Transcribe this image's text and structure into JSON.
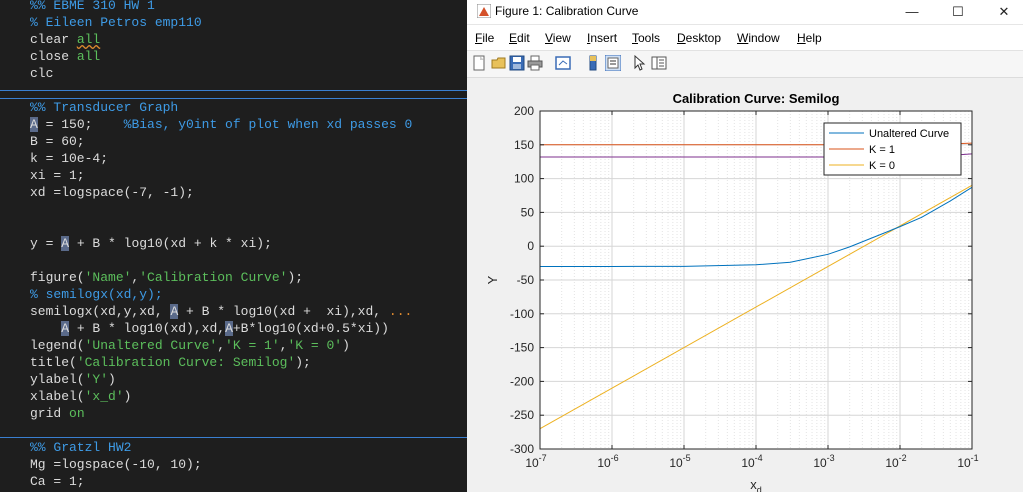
{
  "editor": {
    "lines": [
      {
        "id": "l0",
        "segs": [
          [
            "sec",
            "%% EBME 310 HW 1"
          ]
        ]
      },
      {
        "id": "l1",
        "segs": [
          [
            "cmt",
            "% Eileen Petros emp110"
          ]
        ]
      },
      {
        "id": "l2",
        "segs": [
          [
            "plain",
            "clear "
          ],
          [
            "kwsq",
            "all"
          ]
        ]
      },
      {
        "id": "l3",
        "segs": [
          [
            "plain",
            "close "
          ],
          [
            "kw",
            "all"
          ]
        ]
      },
      {
        "id": "l4",
        "segs": [
          [
            "plain",
            "clc"
          ]
        ]
      },
      {
        "id": "l5",
        "segs": [
          [
            "sec",
            "%% Transducer Graph"
          ]
        ]
      },
      {
        "id": "l6",
        "segs": [
          [
            "hl",
            "A"
          ],
          [
            "plain",
            " = 150;    "
          ],
          [
            "cmt",
            "%Bias, y0int of plot when xd passes 0"
          ]
        ]
      },
      {
        "id": "l7",
        "segs": [
          [
            "plain",
            "B = 60;"
          ]
        ]
      },
      {
        "id": "l8",
        "segs": [
          [
            "plain",
            "k = 10e-4;"
          ]
        ]
      },
      {
        "id": "l9",
        "segs": [
          [
            "plain",
            "xi = 1;"
          ]
        ]
      },
      {
        "id": "l10",
        "segs": [
          [
            "plain",
            "xd =logspace(-7, -1);"
          ]
        ]
      },
      {
        "id": "l11",
        "segs": [
          [
            "plain",
            "y = "
          ],
          [
            "hl",
            "A"
          ],
          [
            "plain",
            " + B * log10(xd + k * xi);"
          ]
        ]
      },
      {
        "id": "l12",
        "segs": [
          [
            "plain",
            "figure("
          ],
          [
            "str",
            "'Name'"
          ],
          [
            "plain",
            ","
          ],
          [
            "str",
            "'Calibration Curve'"
          ],
          [
            "plain",
            ");"
          ]
        ]
      },
      {
        "id": "l13",
        "segs": [
          [
            "cmt",
            "% semilogx(xd,y);"
          ]
        ]
      },
      {
        "id": "l14",
        "segs": [
          [
            "plain",
            "semilogx(xd,y,xd, "
          ],
          [
            "hl",
            "A"
          ],
          [
            "plain",
            " + B * log10(xd +  xi),xd, "
          ],
          [
            "cont",
            "..."
          ]
        ]
      },
      {
        "id": "l15",
        "segs": [
          [
            "plain",
            "    "
          ],
          [
            "hl",
            "A"
          ],
          [
            "plain",
            " + B * log10(xd),xd,"
          ],
          [
            "hl",
            "A"
          ],
          [
            "plain",
            "+B*log10(xd+0.5*xi))"
          ]
        ]
      },
      {
        "id": "l16",
        "segs": [
          [
            "plain",
            "legend("
          ],
          [
            "str",
            "'Unaltered Curve'"
          ],
          [
            "plain",
            ","
          ],
          [
            "str",
            "'K = 1'"
          ],
          [
            "plain",
            ","
          ],
          [
            "str",
            "'K = 0'"
          ],
          [
            "plain",
            ")"
          ]
        ]
      },
      {
        "id": "l17",
        "segs": [
          [
            "plain",
            "title("
          ],
          [
            "str",
            "'Calibration Curve: Semilog'"
          ],
          [
            "plain",
            ");"
          ]
        ]
      },
      {
        "id": "l18",
        "segs": [
          [
            "plain",
            "ylabel("
          ],
          [
            "str",
            "'Y'"
          ],
          [
            "plain",
            ")"
          ]
        ]
      },
      {
        "id": "l19",
        "segs": [
          [
            "plain",
            "xlabel("
          ],
          [
            "str",
            "'x_d'"
          ],
          [
            "plain",
            ")"
          ]
        ]
      },
      {
        "id": "l20",
        "segs": [
          [
            "plain",
            "grid "
          ],
          [
            "kw",
            "on"
          ]
        ]
      },
      {
        "id": "l21",
        "segs": [
          [
            "sec",
            "%% Gratzl HW2"
          ]
        ]
      },
      {
        "id": "l22",
        "segs": [
          [
            "plain",
            "Mg =logspace(-10, 10);"
          ]
        ]
      },
      {
        "id": "l23",
        "segs": [
          [
            "plain",
            "Ca = 1;"
          ]
        ]
      }
    ]
  },
  "window": {
    "title": "Figure 1: Calibration Curve",
    "controls": {
      "minimize": "—",
      "maximize": "☐",
      "close": "✕"
    }
  },
  "menu": {
    "items": [
      {
        "key": "F",
        "rest": "ile"
      },
      {
        "key": "E",
        "rest": "dit"
      },
      {
        "key": "V",
        "rest": "iew"
      },
      {
        "key": "I",
        "rest": "nsert"
      },
      {
        "key": "T",
        "rest": "ools"
      },
      {
        "key": "D",
        "rest": "esktop"
      },
      {
        "key": "W",
        "rest": "indow"
      },
      {
        "key": "H",
        "rest": "elp"
      }
    ]
  },
  "toolbar": {
    "icons": [
      "new-figure-icon",
      "open-file-icon",
      "save-icon",
      "print-icon",
      "link-plot-icon",
      "colorbar-icon",
      "legend-icon",
      "edit-plot-arrow-icon",
      "property-inspector-icon"
    ]
  },
  "colors": {
    "unaltered": "#0072BD",
    "k1": "#D95319",
    "k0": "#EDB120",
    "fourth": "#7E2F8E"
  },
  "chart_data": {
    "type": "line",
    "title": "Calibration Curve: Semilog",
    "xlabel": "x_d",
    "ylabel": "Y",
    "xscale": "log",
    "xlim": [
      1e-07,
      0.1
    ],
    "ylim": [
      -300,
      200
    ],
    "xticks": [
      "10^-7",
      "10^-6",
      "10^-5",
      "10^-4",
      "10^-3",
      "10^-2",
      "10^-1"
    ],
    "yticks": [
      "200",
      "150",
      "100",
      "50",
      "0",
      "-50",
      "-100",
      "-150",
      "-200",
      "-250",
      "-300"
    ],
    "grid": true,
    "legend_position": "top-right",
    "series": [
      {
        "name": "Unaltered Curve",
        "color": "#0072BD",
        "x": [
          1e-07,
          1e-06,
          1e-05,
          0.0001,
          0.0003,
          0.001,
          0.002,
          0.005,
          0.01,
          0.02,
          0.05,
          0.1
        ],
        "values": [
          -30.0,
          -30.0,
          -29.8,
          -27.5,
          -23.8,
          -12.0,
          -1.0,
          16.0,
          29.0,
          42.7,
          66.9,
          87.2
        ]
      },
      {
        "name": "K = 1",
        "color": "#D95319",
        "x": [
          1e-07,
          0.001,
          0.01,
          0.05,
          0.1
        ],
        "values": [
          150,
          150,
          150.3,
          151.3,
          152.5
        ]
      },
      {
        "name": "K = 0",
        "color": "#EDB120",
        "x": [
          1e-07,
          0.1
        ],
        "values": [
          -270,
          90
        ]
      },
      {
        "color": "#7E2F8E",
        "x": [
          1e-07,
          0.001,
          0.01,
          0.05,
          0.1
        ],
        "values": [
          131.9,
          131.9,
          132.4,
          134.4,
          136.5
        ]
      }
    ]
  }
}
